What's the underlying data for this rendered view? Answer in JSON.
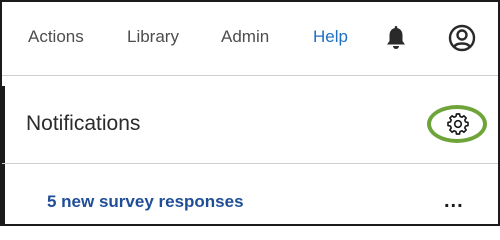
{
  "nav": {
    "items": [
      {
        "label": "Actions"
      },
      {
        "label": "Library"
      },
      {
        "label": "Admin"
      },
      {
        "label": "Help",
        "active": true
      }
    ],
    "icons": {
      "notifications": "bell-icon",
      "account": "user-circle-icon"
    }
  },
  "notifications": {
    "title": "Notifications",
    "settings_icon": "gear-icon",
    "highlight_color": "#6ea43a",
    "items": [
      {
        "label": "5 new survey responses",
        "menu_label": "..."
      }
    ]
  },
  "colors": {
    "link": "#1f4e96",
    "active_nav": "#1f6fc2"
  }
}
